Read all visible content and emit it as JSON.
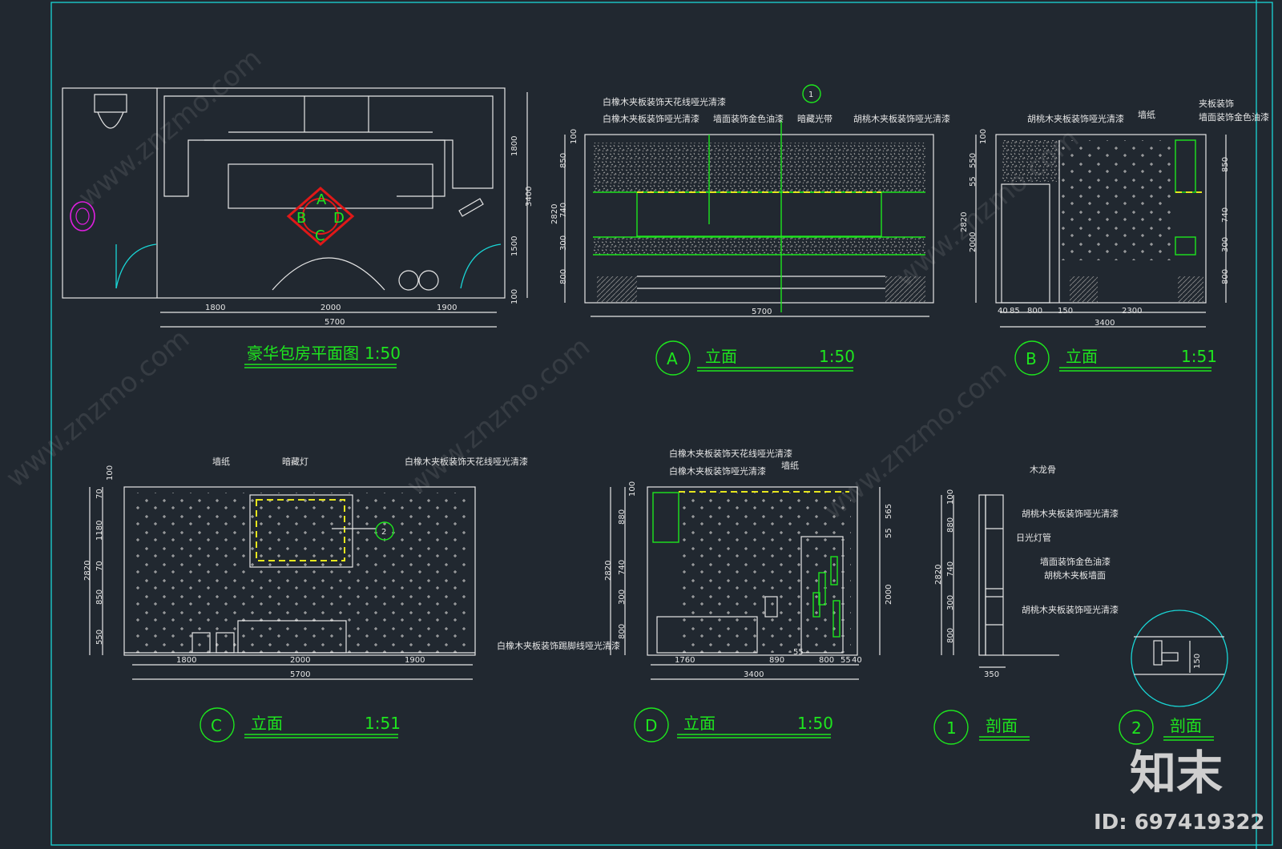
{
  "plan": {
    "title": "豪华包房平面图",
    "scale": "1:50",
    "dims": [
      "1800",
      "2000",
      "1900",
      "5700"
    ],
    "vdims": [
      "1800",
      "3400",
      "1500",
      "100"
    ],
    "tags": [
      "A",
      "B",
      "C",
      "D"
    ]
  },
  "elev_a": {
    "tag": "A",
    "title": "立面",
    "scale": "1:50",
    "dims": [
      "5700"
    ],
    "vdims": [
      "100",
      "850",
      "740",
      "2820",
      "300",
      "800"
    ],
    "notes": [
      "白橡木夹板装饰天花线哑光清漆",
      "白橡木夹板装饰哑光清漆",
      "墙面装饰金色油漆",
      "暗藏光带",
      "胡桃木夹板装饰哑光清漆"
    ],
    "marker": "1"
  },
  "elev_b": {
    "tag": "B",
    "title": "立面",
    "scale": "1:51",
    "dims": [
      "40",
      "85",
      "800",
      "150",
      "2300",
      "3400"
    ],
    "vdims": [
      "100",
      "550",
      "55",
      "2820",
      "2000",
      "850",
      "740",
      "300",
      "800"
    ],
    "notes": [
      "胡桃木夹板装饰哑光清漆",
      "墙纸",
      "夹板装饰",
      "墙面装饰金色油漆"
    ]
  },
  "elev_c": {
    "tag": "C",
    "title": "立面",
    "scale": "1:51",
    "dims": [
      "1800",
      "2000",
      "1900",
      "5700"
    ],
    "vdims": [
      "100",
      "70",
      "1180",
      "70",
      "2820",
      "850",
      "550"
    ],
    "notes": [
      "墙纸",
      "暗藏灯",
      "白橡木夹板装饰天花线哑光清漆",
      "白橡木夹板装饰踢脚线哑光清漆"
    ],
    "marker": "2"
  },
  "elev_d": {
    "tag": "D",
    "title": "立面",
    "scale": "1:50",
    "dims": [
      "1760",
      "890",
      "55",
      "800",
      "55",
      "40",
      "3400"
    ],
    "vdims": [
      "100",
      "880",
      "2820",
      "740",
      "300",
      "800",
      "565",
      "55",
      "2000"
    ],
    "notes": [
      "白橡木夹板装饰天花线哑光清漆",
      "白橡木夹板装饰哑光清漆",
      "墙纸"
    ]
  },
  "sec1": {
    "tag": "1",
    "title": "剖面",
    "dims": [
      "350"
    ],
    "vdims": [
      "100",
      "880",
      "2820",
      "740",
      "300",
      "800"
    ],
    "notes": [
      "木龙骨",
      "胡桃木夹板装饰哑光清漆",
      "日光灯管",
      "墙面装饰金色油漆",
      "胡桃木夹板墙面",
      "胡桃木夹板装饰哑光清漆"
    ]
  },
  "sec2": {
    "tag": "2",
    "title": "剖面",
    "dim": "150"
  },
  "brand": {
    "logo": "知末",
    "id": "ID: 697419322"
  },
  "watermark": "www.znzmo.com",
  "colors": {
    "bg": "#212830",
    "green": "#1ee61e",
    "cyan": "#19d6d6",
    "white": "#e6e6e6",
    "yellow": "#e6e61e",
    "red": "#e01818"
  }
}
